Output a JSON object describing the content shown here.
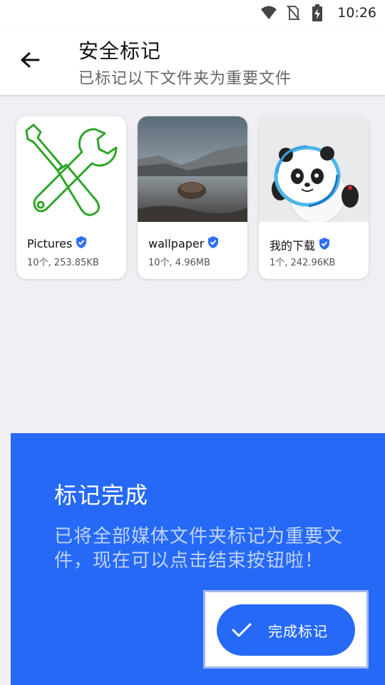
{
  "status_bar": {
    "time": "10:26",
    "icons": [
      "wifi-icon",
      "no-sim-icon",
      "battery-charging-icon"
    ]
  },
  "header": {
    "title": "安全标记",
    "subtitle": "已标记以下文件夹为重要文件",
    "back_icon": "arrow-back-icon"
  },
  "folders": [
    {
      "name": "Pictures",
      "meta": "10个, 253.85KB",
      "thumb": "tools-icon",
      "verified": true
    },
    {
      "name": "wallpaper",
      "meta": "10个, 4.96MB",
      "thumb": "lake-photo",
      "verified": true
    },
    {
      "name": "我的下载",
      "meta": "1个, 242.96KB",
      "thumb": "mascot-photo",
      "verified": true
    }
  ],
  "sheet": {
    "title": "标记完成",
    "message": "已将全部媒体文件夹标记为重要文件，现在可以点击结束按钮啦！",
    "button_label": "完成标记",
    "button_icon": "check-icon"
  },
  "colors": {
    "accent": "#2669f6",
    "verified_badge": "#2f6ef7",
    "tool_green": "#2fa52a"
  }
}
